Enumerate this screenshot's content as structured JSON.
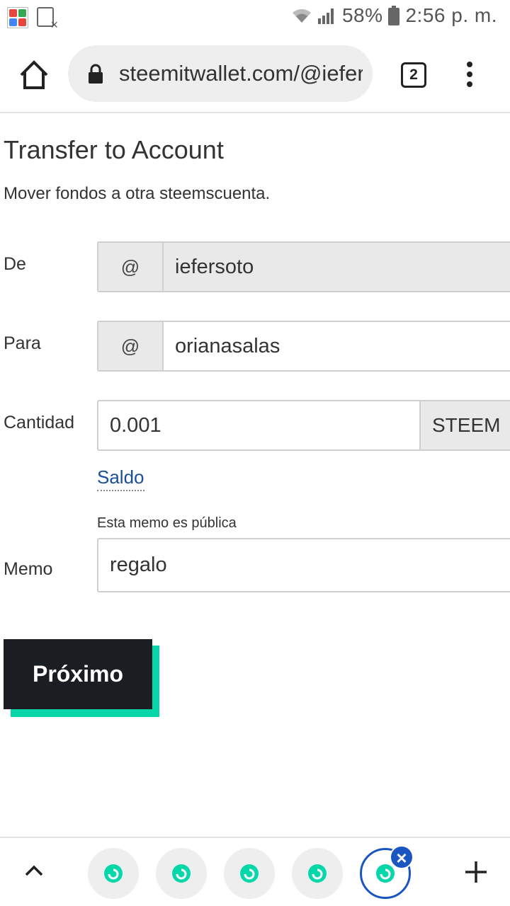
{
  "status_bar": {
    "battery_percent": "58%",
    "time": "2:56 p. m."
  },
  "browser": {
    "url": "steemitwallet.com/@iefersoto",
    "tab_count": "2"
  },
  "page": {
    "title": "Transfer to Account",
    "subtitle": "Mover fondos a otra steemscuenta."
  },
  "form": {
    "from": {
      "label": "De",
      "prefix": "@",
      "value": "iefersoto"
    },
    "to": {
      "label": "Para",
      "prefix": "@",
      "value": "orianasalas"
    },
    "amount": {
      "label": "Cantidad",
      "value": "0.001",
      "currency": "STEEM"
    },
    "balance_link": "Saldo",
    "memo": {
      "label": "Memo",
      "hint": "Esta memo es pública",
      "value": "regalo"
    },
    "next_label": "Próximo"
  },
  "colors": {
    "accent": "#06d6a9",
    "button_bg": "#1a1e23",
    "link": "#1a5099",
    "active_tab": "#1a56c2"
  }
}
